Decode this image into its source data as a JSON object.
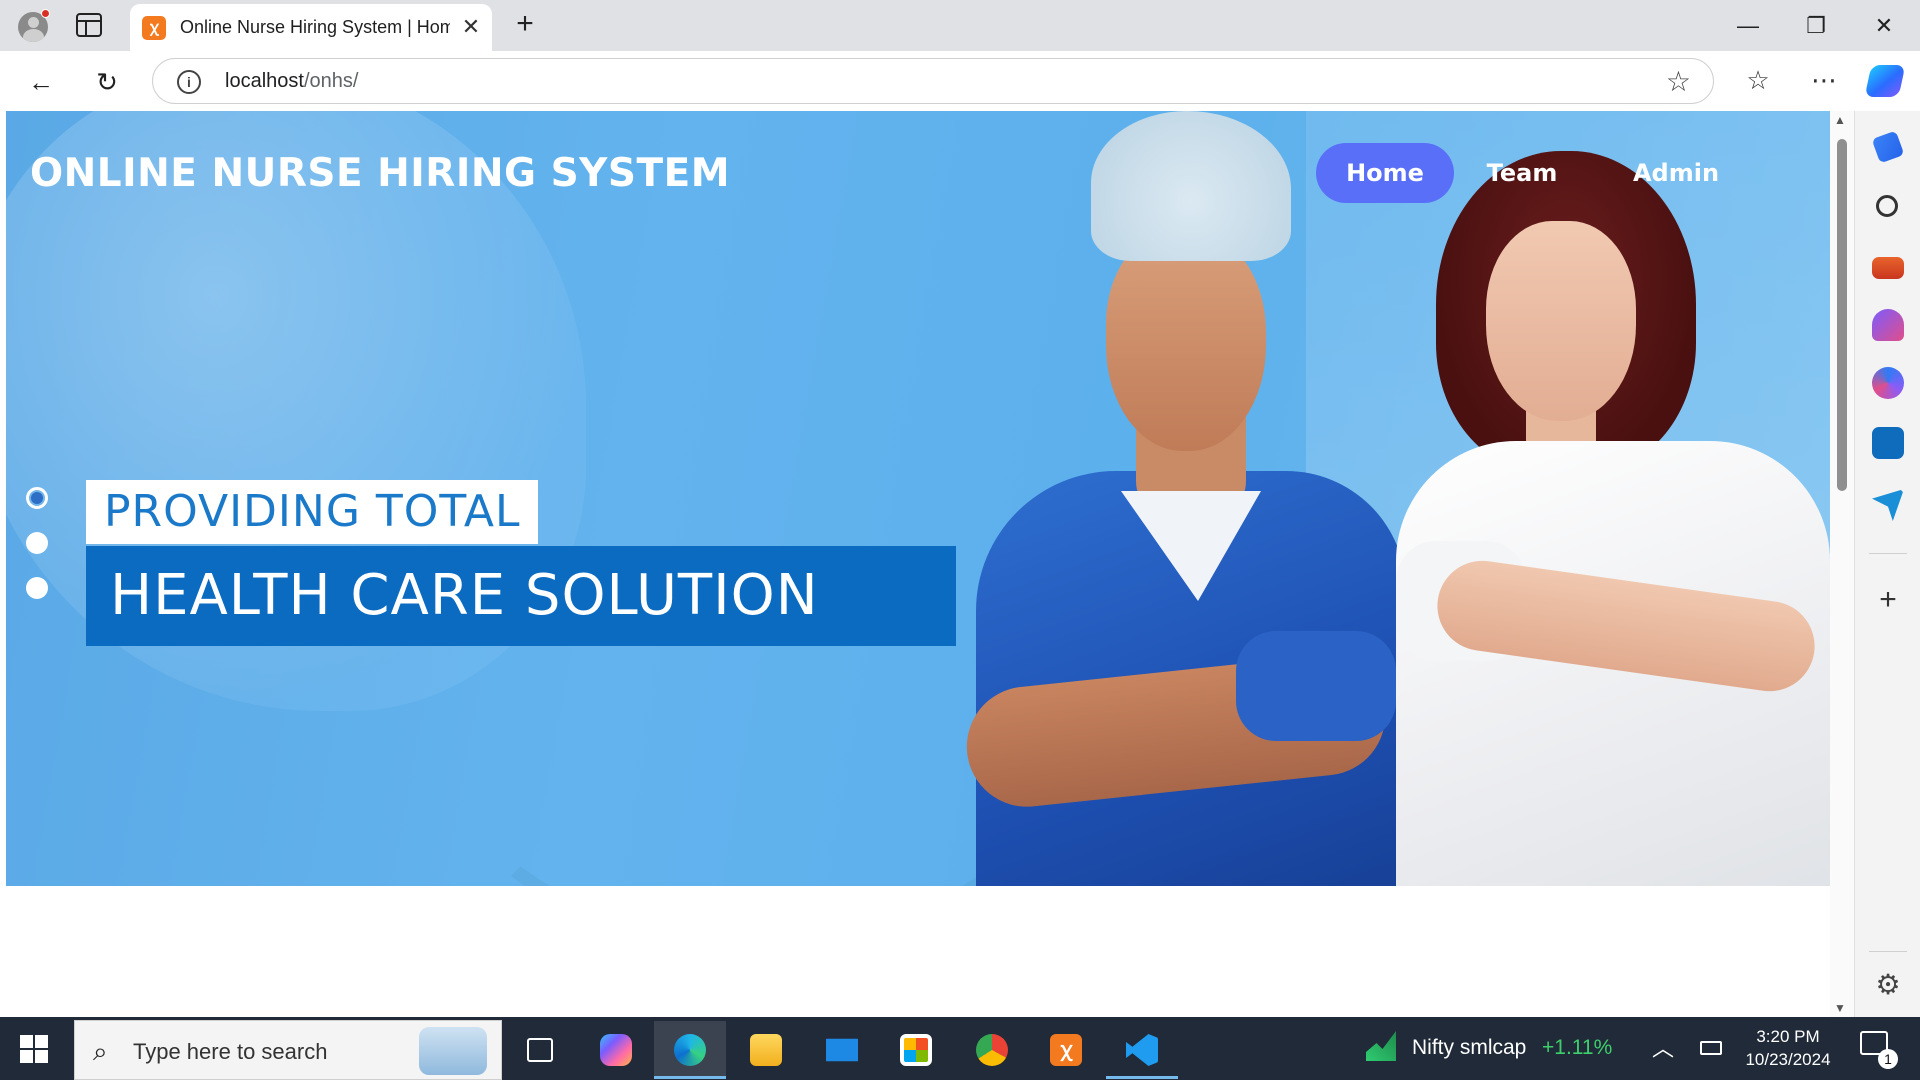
{
  "browser": {
    "tab_title": "Online Nurse Hiring System | Hom",
    "tab_close": "✕",
    "new_tab": "+",
    "url_host": "localhost",
    "url_path": "/onhs/",
    "window_controls": {
      "minimize": "—",
      "restore": "❐",
      "close": "✕"
    }
  },
  "site": {
    "title": "ONLINE NURSE HIRING SYSTEM",
    "nav": [
      {
        "label": "Home",
        "active": true
      },
      {
        "label": "Team",
        "active": false
      },
      {
        "label": "Admin",
        "active": false
      }
    ],
    "slider": {
      "active_index": 0,
      "count": 3,
      "line1": "PROVIDING TOTAL",
      "line2": "HEALTH CARE SOLUTION"
    }
  },
  "sidebar_icons": [
    "tag-icon",
    "search-icon",
    "toolbox-icon",
    "games-icon",
    "m365-icon",
    "outlook-icon",
    "send-icon",
    "add-icon",
    "settings-icon"
  ],
  "taskbar": {
    "search_placeholder": "Type here to search",
    "apps": [
      "task-view",
      "copilot",
      "edge",
      "file-explorer",
      "mail",
      "store",
      "chrome",
      "xampp",
      "vscode"
    ],
    "stock_name": "Nifty smlcap",
    "stock_change": "+1.11%",
    "time": "3:20 PM",
    "date": "10/23/2024",
    "notification_count": "1"
  },
  "colors": {
    "hero_blue": "#5cb0ec",
    "nav_active": "#5a6ff7",
    "banner_blue": "#0a6bc1",
    "banner_text_blue": "#1b79c9",
    "stock_green": "#3ecf6a"
  }
}
